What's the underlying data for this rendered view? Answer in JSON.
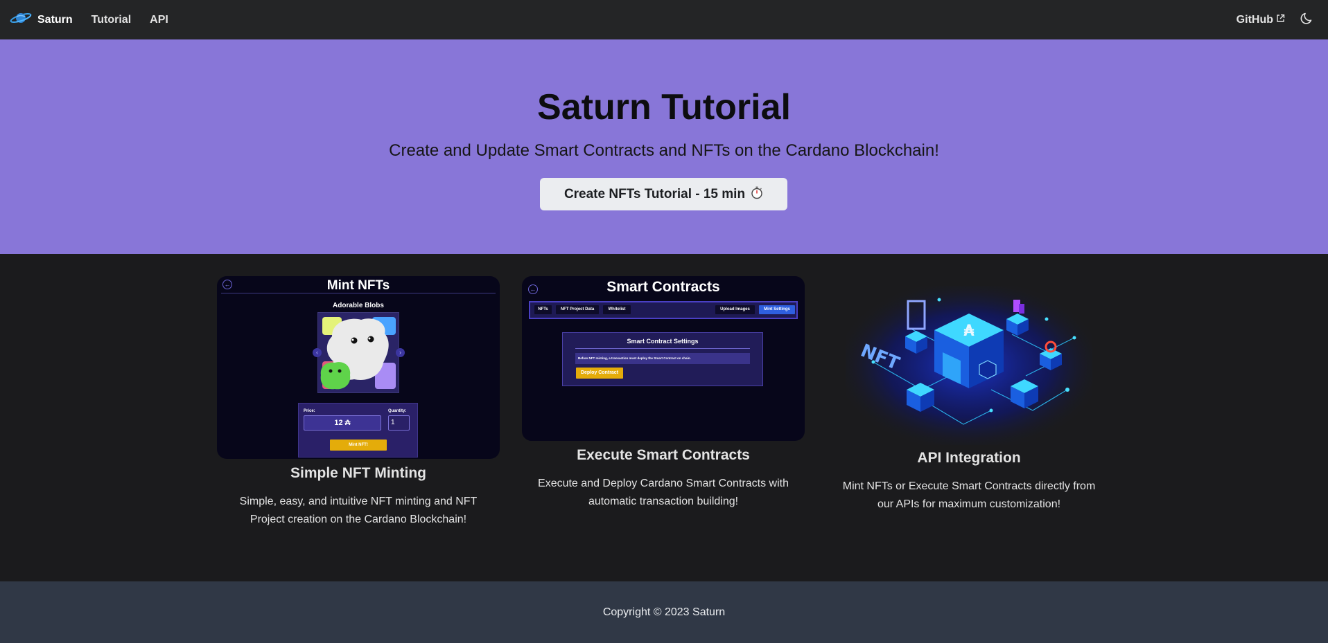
{
  "navbar": {
    "brand": "Saturn",
    "links": [
      {
        "label": "Tutorial"
      },
      {
        "label": "API"
      }
    ],
    "github_label": "GitHub",
    "logo_icon": "saturn-planet-icon",
    "external_icon": "external-link-icon",
    "theme_icon": "moon-icon"
  },
  "hero": {
    "title": "Saturn Tutorial",
    "subtitle": "Create and Update Smart Contracts and NFTs on the Cardano Blockchain!",
    "cta_label": "Create NFTs Tutorial - 15 min",
    "cta_icon": "⏱️"
  },
  "features": [
    {
      "title": "Simple NFT Minting",
      "description": "Simple, easy, and intuitive NFT minting and NFT Project creation on the Cardano Blockchain!",
      "mock": {
        "heading": "Mint NFTs",
        "project": "Adorable Blobs",
        "price_label": "Price:",
        "price_value": "12 ₳",
        "quantity_label": "Quantity:",
        "quantity_value": "1",
        "mint_button": "Mint NFT!"
      }
    },
    {
      "title": "Execute Smart Contracts",
      "description": "Execute and Deploy Cardano Smart Contracts with automatic transaction building!",
      "mock": {
        "heading": "Smart Contracts",
        "tabs": [
          "NFTs",
          "NFT Project Data",
          "Whitelist",
          "Upload Images",
          "Mint Settings"
        ],
        "card_title": "Smart Contract Settings",
        "note": "Before NFT minting, a transaction must deploy the Smart Contract on chain.",
        "deploy_button": "Deploy Contract"
      }
    },
    {
      "title": "API Integration",
      "description": "Mint NFTs or Execute Smart Contracts directly from our APIs for maximum customization!",
      "art": {
        "nft_text": "NFT",
        "symbol": "₳"
      }
    }
  ],
  "footer": {
    "copyright": "Copyright © 2023 Saturn"
  },
  "colors": {
    "hero_bg": "#8876d8",
    "navbar_bg": "#242526",
    "page_bg": "#1b1b1d",
    "footer_bg": "#303846",
    "accent_gold": "#e4ac0a",
    "tab_active": "#2e5fe0"
  }
}
